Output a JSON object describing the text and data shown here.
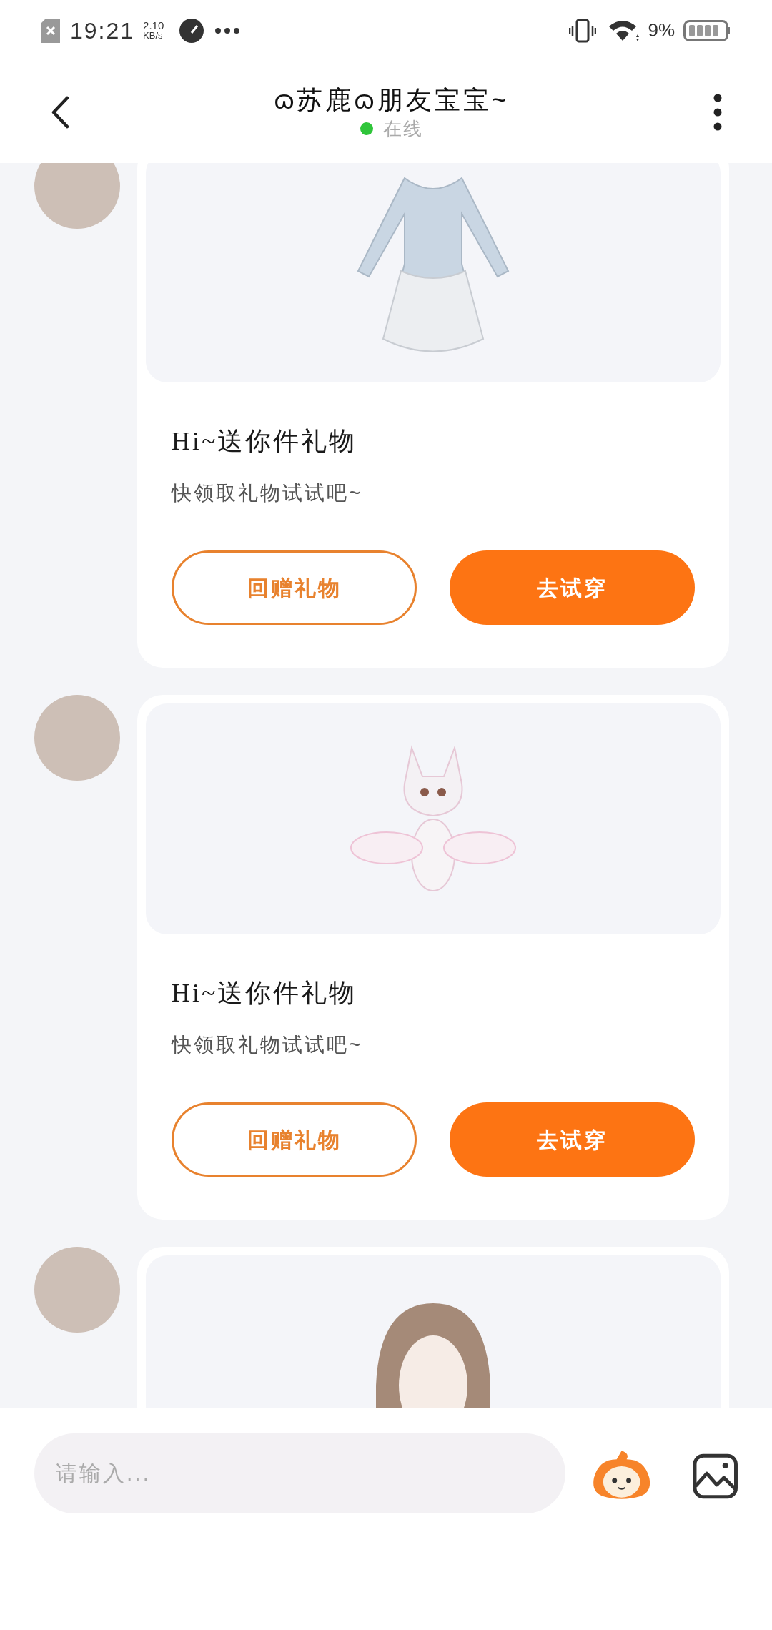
{
  "status_bar": {
    "time": "19:21",
    "net_speed": "2.10",
    "net_unit": "KB/s",
    "battery": "9%"
  },
  "header": {
    "title": "ɷ苏鹿ɷ朋友宝宝~",
    "status": "在线",
    "online": true
  },
  "messages": [
    {
      "kind": "dress",
      "title": "Hi~送你件礼物",
      "subtitle": "快领取礼物试试吧~",
      "buttons": [
        {
          "label": "回赠礼物",
          "kind": "outline"
        },
        {
          "label": "去试穿",
          "kind": "filled"
        }
      ]
    },
    {
      "kind": "fox",
      "title": "Hi~送你件礼物",
      "subtitle": "快领取礼物试试吧~",
      "buttons": [
        {
          "label": "回赠礼物",
          "kind": "outline"
        },
        {
          "label": "去试穿",
          "kind": "filled"
        }
      ]
    },
    {
      "kind": "hair"
    }
  ],
  "input": {
    "placeholder": "请输入..."
  }
}
